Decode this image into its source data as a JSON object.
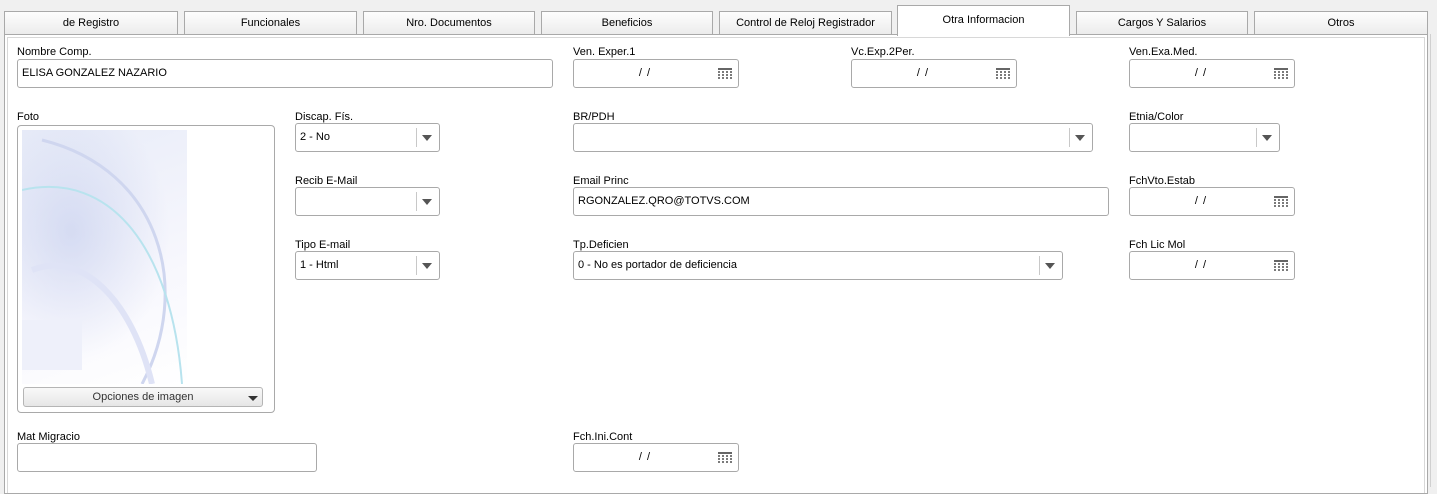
{
  "tabs": [
    {
      "label": "de Registro",
      "active": false
    },
    {
      "label": "Funcionales",
      "active": false
    },
    {
      "label": "Nro. Documentos",
      "active": false
    },
    {
      "label": "Beneficios",
      "active": false
    },
    {
      "label": "Control de Reloj Registrador",
      "active": false
    },
    {
      "label": "Otra Informacion",
      "active": true
    },
    {
      "label": "Cargos Y Salarios",
      "active": false
    },
    {
      "label": "Otros",
      "active": false
    }
  ],
  "form": {
    "nombre_comp": {
      "label": "Nombre Comp.",
      "value": "ELISA  GONZALEZ NAZARIO"
    },
    "ven_exper1": {
      "label": "Ven. Exper.1",
      "value": "/ /"
    },
    "vc_exp2per": {
      "label": "Vc.Exp.2Per.",
      "value": "/ /"
    },
    "ven_exa_med": {
      "label": "Ven.Exa.Med.",
      "value": "/ /"
    },
    "foto": {
      "label": "Foto",
      "options_label": "Opciones de imagen"
    },
    "discap_fis": {
      "label": "Discap. Fís.",
      "value": "2 - No"
    },
    "br_pdh": {
      "label": "BR/PDH",
      "value": ""
    },
    "etnia_color": {
      "label": "Etnia/Color",
      "value": ""
    },
    "recib_email": {
      "label": "Recib E-Mail",
      "value": ""
    },
    "email_princ": {
      "label": "Email Princ",
      "value": "RGONZALEZ.QRO@TOTVS.COM"
    },
    "fch_vto_estab": {
      "label": "FchVto.Estab",
      "value": "/ /"
    },
    "tipo_email": {
      "label": "Tipo E-mail",
      "value": "1 - Html"
    },
    "tp_deficien": {
      "label": "Tp.Deficien",
      "value": "0 - No es portador de deficiencia"
    },
    "fch_lic_mol": {
      "label": "Fch Lic Mol",
      "value": "/ /"
    },
    "mat_migracio": {
      "label": "Mat Migracio",
      "value": ""
    },
    "fch_ini_cont": {
      "label": "Fch.Ini.Cont",
      "value": "/ /"
    }
  }
}
